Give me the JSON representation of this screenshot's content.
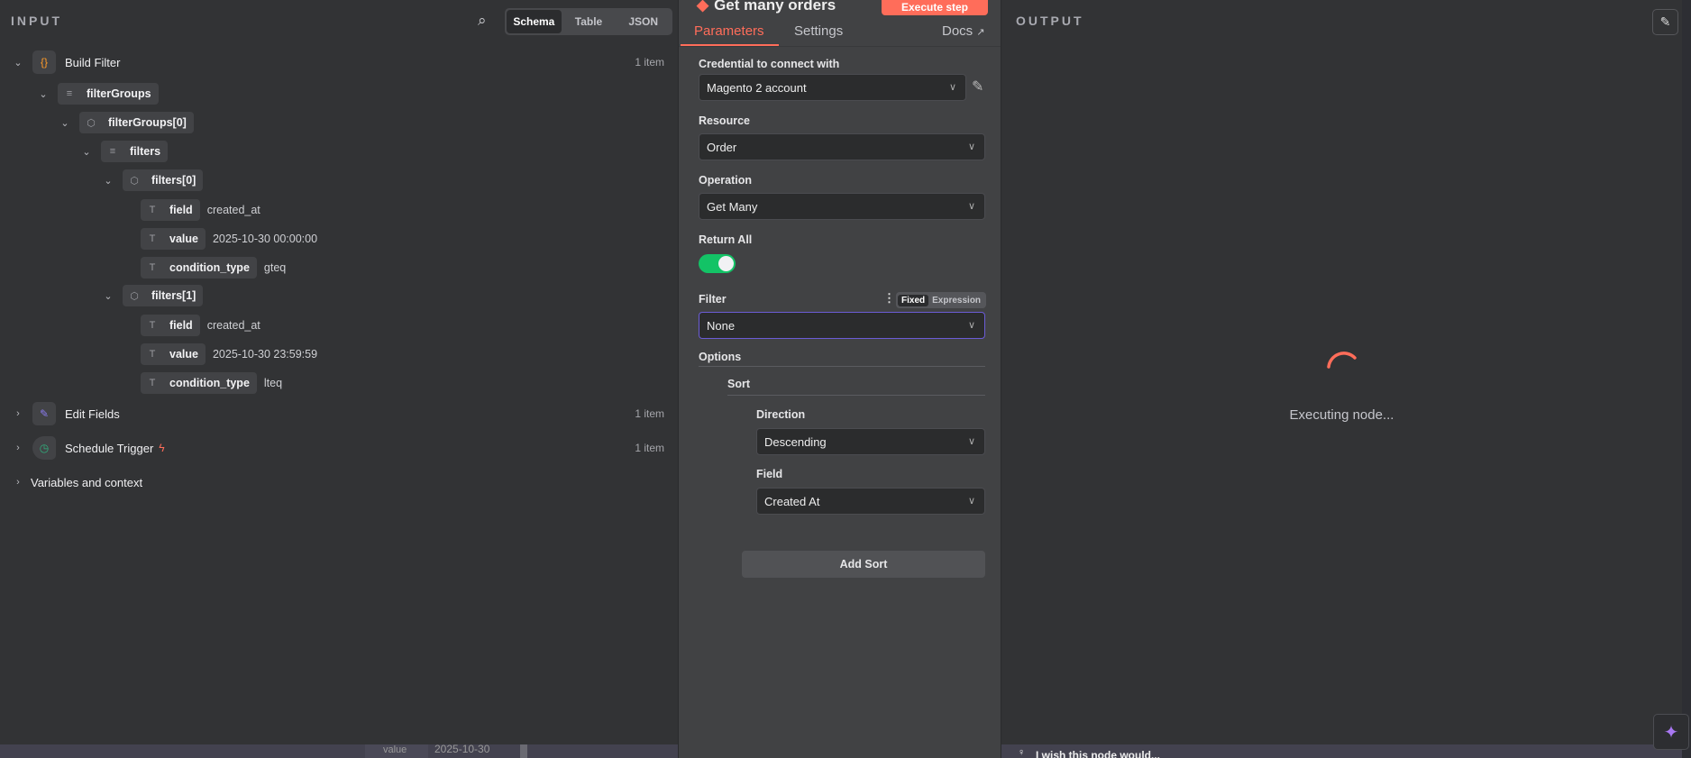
{
  "input": {
    "title": "INPUT",
    "views": [
      "Schema",
      "Table",
      "JSON"
    ],
    "active_view": "Schema"
  },
  "tree": {
    "build_filter": {
      "name": "Build Filter",
      "count": "1 item"
    },
    "filterGroups": "filterGroups",
    "filterGroups0": "filterGroups[0]",
    "filters": "filters",
    "filters0": {
      "label": "filters[0]",
      "fields": [
        {
          "key": "field",
          "value": "created_at"
        },
        {
          "key": "value",
          "value": "2025-10-30 00:00:00"
        },
        {
          "key": "condition_type",
          "value": "gteq"
        }
      ]
    },
    "filters1": {
      "label": "filters[1]",
      "fields": [
        {
          "key": "field",
          "value": "created_at"
        },
        {
          "key": "value",
          "value": "2025-10-30 23:59:59"
        },
        {
          "key": "condition_type",
          "value": "lteq"
        }
      ]
    },
    "edit_fields": {
      "name": "Edit Fields",
      "count": "1 item"
    },
    "schedule_trigger": {
      "name": "Schedule Trigger",
      "count": "1 item"
    },
    "variables": "Variables and context"
  },
  "node": {
    "title": "Get many orders",
    "execute": "Execute step",
    "tabs": [
      "Parameters",
      "Settings"
    ],
    "docs": "Docs",
    "credential_label": "Credential to connect with",
    "credential": "Magento 2 account",
    "resource_label": "Resource",
    "resource": "Order",
    "operation_label": "Operation",
    "operation": "Get Many",
    "return_all_label": "Return All",
    "return_all": true,
    "filter_label": "Filter",
    "filter_modes": [
      "Fixed",
      "Expression"
    ],
    "filter": "None",
    "options_label": "Options",
    "sort_label": "Sort",
    "direction_label": "Direction",
    "direction": "Descending",
    "field_label": "Field",
    "field": "Created At",
    "add_sort": "Add Sort"
  },
  "output": {
    "title": "OUTPUT",
    "status": "Executing node..."
  },
  "background": {
    "value_key": "value",
    "value_text": "2025-10-30",
    "feedback": "I wish this node would..."
  },
  "colors": {
    "accent": "#ff6d5a",
    "toggle_on": "#13c366",
    "focus": "#6b5cd6"
  }
}
